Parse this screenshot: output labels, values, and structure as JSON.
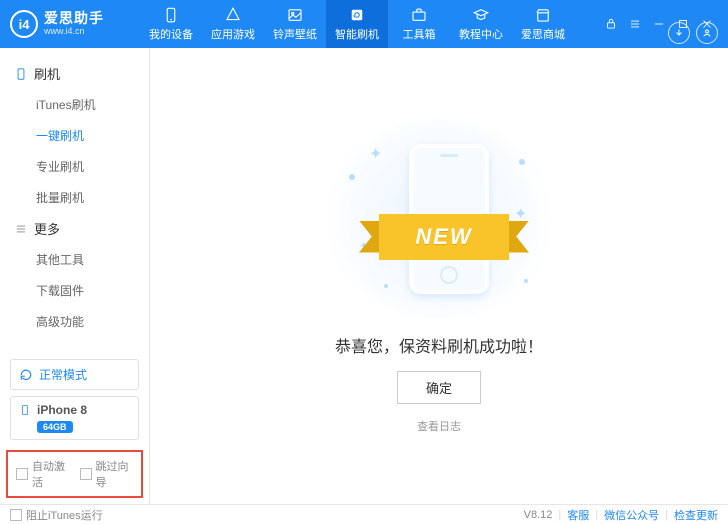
{
  "logo": {
    "abbr": "i4",
    "title": "爱思助手",
    "url": "www.i4.cn"
  },
  "nav": {
    "items": [
      {
        "label": "我的设备"
      },
      {
        "label": "应用游戏"
      },
      {
        "label": "铃声壁纸"
      },
      {
        "label": "智能刷机"
      },
      {
        "label": "工具箱"
      },
      {
        "label": "教程中心"
      },
      {
        "label": "爱思商城"
      }
    ]
  },
  "sidebar": {
    "flash_head": "刷机",
    "flash_items": [
      "iTunes刷机",
      "一键刷机",
      "专业刷机",
      "批量刷机"
    ],
    "more_head": "更多",
    "more_items": [
      "其他工具",
      "下载固件",
      "高级功能"
    ],
    "mode": "正常模式",
    "device": {
      "name": "iPhone 8",
      "storage": "64GB"
    },
    "options": {
      "auto_activate": "自动激活",
      "skip_wizard": "跳过向导"
    }
  },
  "main": {
    "ribbon": "NEW",
    "success": "恭喜您，保资料刷机成功啦！",
    "confirm": "确定",
    "log": "查看日志"
  },
  "status": {
    "block_itunes": "阻止iTunes运行",
    "version": "V8.12",
    "support": "客服",
    "wechat": "微信公众号",
    "update": "检查更新"
  }
}
